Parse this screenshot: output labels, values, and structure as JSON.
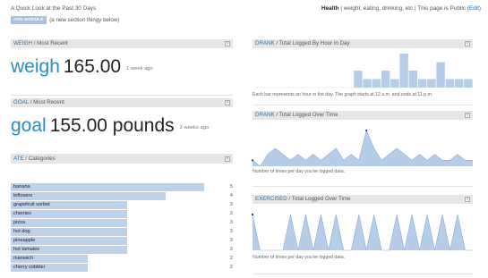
{
  "topbar": {
    "range": "A Quick Look at the Past 30 Days",
    "section": "Health",
    "section_desc": " | weight, eating, drinking, etc | This page is ",
    "visibility": "Public",
    "edit_open": " (",
    "edit": "Edit",
    "edit_close": ")"
  },
  "add_module": {
    "button": "ADD MODULE",
    "note": "(a new section thingy below)"
  },
  "colors": {
    "accent": "#2a8bc4",
    "bar": "#bed1ea",
    "header": "#e6e6e6",
    "chart_fill": "#b6cde9",
    "chart_line": "#8aaad1"
  },
  "widgets": {
    "weigh": {
      "keyword": "WEIGH",
      "title": " / Most Recent",
      "value_keyword": "weigh",
      "value": "165.00",
      "ago": "1 week ago"
    },
    "goal": {
      "keyword": "GOAL",
      "title": " / Most Recent",
      "value_keyword": "goal",
      "value": "155.00 pounds",
      "ago": "2 weeks ago"
    },
    "ate": {
      "keyword": "ATE",
      "title": " / Categories",
      "items": [
        {
          "label": "banana",
          "count": 5
        },
        {
          "label": "leftovers",
          "count": 4
        },
        {
          "label": "grapefruit sorbet",
          "count": 3
        },
        {
          "label": "cherries",
          "count": 3
        },
        {
          "label": "pizza",
          "count": 3
        },
        {
          "label": "hot dog",
          "count": 3
        },
        {
          "label": "pineapple",
          "count": 3
        },
        {
          "label": "hot tamales",
          "count": 3
        },
        {
          "label": "manwich",
          "count": 2
        },
        {
          "label": "cherry cobbler",
          "count": 2
        }
      ]
    },
    "drank_hour": {
      "keyword": "DRANK",
      "title": " / Total Logged By Hour in Day",
      "note": "Each bar represents an hour in the day. The graph starts at 12 a.m. and ends at 11 p.m."
    },
    "drank_time": {
      "keyword": "DRANK",
      "title": " / Total Logged Over Time",
      "note": "Number of times per day you've logged data."
    },
    "exercised": {
      "keyword": "EXERCISED",
      "title": " / Total Logged Over Time",
      "note": "Number of times per day you've logged data."
    }
  },
  "chart_data": [
    {
      "type": "bar",
      "categories": [
        "0",
        "1",
        "2",
        "3",
        "4",
        "5",
        "6",
        "7",
        "8",
        "9",
        "10",
        "11",
        "12",
        "13",
        "14",
        "15",
        "16",
        "17",
        "18",
        "19",
        "20",
        "21",
        "22",
        "23"
      ],
      "values": [
        0,
        0,
        0,
        0,
        0,
        0,
        0,
        0,
        0,
        0,
        0,
        2,
        1,
        1,
        2,
        1,
        4,
        2,
        1,
        1,
        3,
        1,
        1,
        1
      ]
    },
    {
      "type": "area",
      "x": [
        1,
        2,
        3,
        4,
        5,
        6,
        7,
        8,
        9,
        10,
        11,
        12,
        13,
        14,
        15,
        16,
        17,
        18,
        19,
        20,
        21,
        22,
        23,
        24,
        25,
        26,
        27,
        28,
        29,
        30
      ],
      "values": [
        1,
        0,
        2,
        3,
        2,
        1,
        2,
        1,
        2,
        1,
        2,
        3,
        1,
        2,
        1,
        6,
        3,
        1,
        2,
        3,
        2,
        1,
        2,
        1,
        2,
        1,
        1,
        2,
        1,
        1
      ]
    },
    {
      "type": "area",
      "x": [
        1,
        2,
        3,
        4,
        5,
        6,
        7,
        8,
        9,
        10,
        11,
        12,
        13,
        14,
        15,
        16,
        17,
        18,
        19,
        20,
        21,
        22,
        23,
        24,
        25,
        26,
        27,
        28,
        29,
        30
      ],
      "values": [
        1,
        0,
        0,
        0,
        0,
        1,
        0,
        1,
        0,
        1,
        0,
        1,
        0,
        0,
        1,
        0,
        1,
        0,
        0,
        1,
        0,
        1,
        0,
        1,
        0,
        1,
        0,
        1,
        0,
        0
      ]
    }
  ]
}
